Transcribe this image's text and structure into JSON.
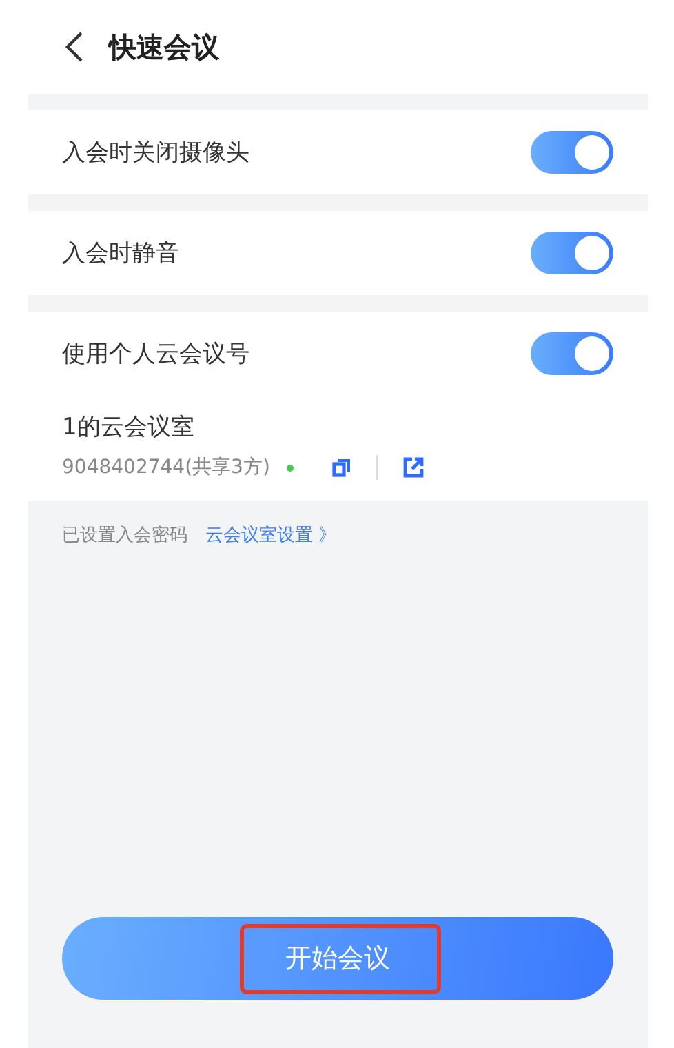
{
  "header": {
    "title": "快速会议"
  },
  "settings": [
    {
      "label": "入会时关闭摄像头",
      "on": true
    },
    {
      "label": "入会时静音",
      "on": true
    }
  ],
  "personal": {
    "label": "使用个人云会议号",
    "on": true,
    "room_name": "1的云会议室",
    "room_number": "9048402744(共享3方)"
  },
  "password_note": "已设置入会密码",
  "room_settings_link": "云会议室设置 》",
  "start_button": {
    "label": "开始会议",
    "highlighted": true
  }
}
